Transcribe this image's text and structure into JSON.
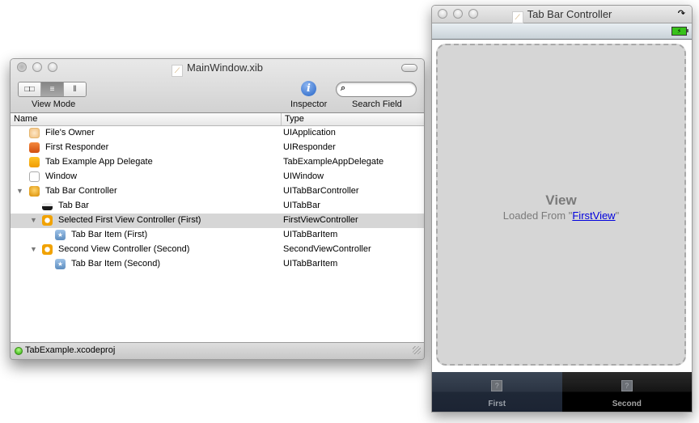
{
  "main_window": {
    "title": "MainWindow.xib",
    "toolbar": {
      "view_mode_label": "View Mode",
      "view_modes": [
        {
          "name": "icon-view",
          "glyph": "□□",
          "selected": false
        },
        {
          "name": "list-view",
          "glyph": "≡",
          "selected": true
        },
        {
          "name": "column-view",
          "glyph": "‖",
          "selected": false
        }
      ],
      "inspector_label": "Inspector",
      "inspector_glyph": "i",
      "search_label": "Search Field",
      "search_placeholder": "",
      "search_value": "",
      "search_glyph": "⌕"
    },
    "columns": {
      "name": "Name",
      "type": "Type"
    },
    "rows": [
      {
        "name": "File's Owner",
        "type": "UIApplication",
        "icon": "files-owner-icon",
        "level": 0,
        "disclosure": false
      },
      {
        "name": "First Responder",
        "type": "UIResponder",
        "icon": "first-responder-icon",
        "level": 0,
        "disclosure": false
      },
      {
        "name": "Tab Example App Delegate",
        "type": "TabExampleAppDelegate",
        "icon": "object-cube-icon",
        "level": 0,
        "disclosure": false
      },
      {
        "name": "Window",
        "type": "UIWindow",
        "icon": "window-icon",
        "level": 0,
        "disclosure": false
      },
      {
        "name": "Tab Bar Controller",
        "type": "UITabBarController",
        "icon": "tab-bar-controller-icon",
        "level": 0,
        "disclosure": true
      },
      {
        "name": "Tab Bar",
        "type": "UITabBar",
        "icon": "tab-bar-icon",
        "level": 1,
        "disclosure": false
      },
      {
        "name": "Selected First View Controller (First)",
        "type": "FirstViewController",
        "icon": "view-controller-icon",
        "level": 1,
        "disclosure": true,
        "selected": true
      },
      {
        "name": "Tab Bar Item (First)",
        "type": "UITabBarItem",
        "icon": "tab-bar-item-icon",
        "level": 2,
        "disclosure": false
      },
      {
        "name": "Second View Controller (Second)",
        "type": "SecondViewController",
        "icon": "view-controller-icon",
        "level": 1,
        "disclosure": true
      },
      {
        "name": "Tab Bar Item (Second)",
        "type": "UITabBarItem",
        "icon": "tab-bar-item-icon",
        "level": 2,
        "disclosure": false
      }
    ],
    "status": {
      "project": "TabExample.xcodeproj",
      "status_color": "#22a800"
    }
  },
  "tab_window": {
    "title": "Tab Bar Controller",
    "rotate_glyph": "↷",
    "battery_glyph": "⚡",
    "view": {
      "label": "View",
      "loaded_prefix": "Loaded From \"",
      "loaded_link": "FirstView",
      "loaded_suffix": "\""
    },
    "tabs": [
      {
        "label": "First",
        "glyph": "?",
        "active": true
      },
      {
        "label": "Second",
        "glyph": "?",
        "active": false
      }
    ]
  },
  "colors": {
    "selection_row": "#d6d6d6",
    "link": "#0000dd",
    "tab_active": "#2b3443",
    "inspector_blue": "#2463c6"
  }
}
